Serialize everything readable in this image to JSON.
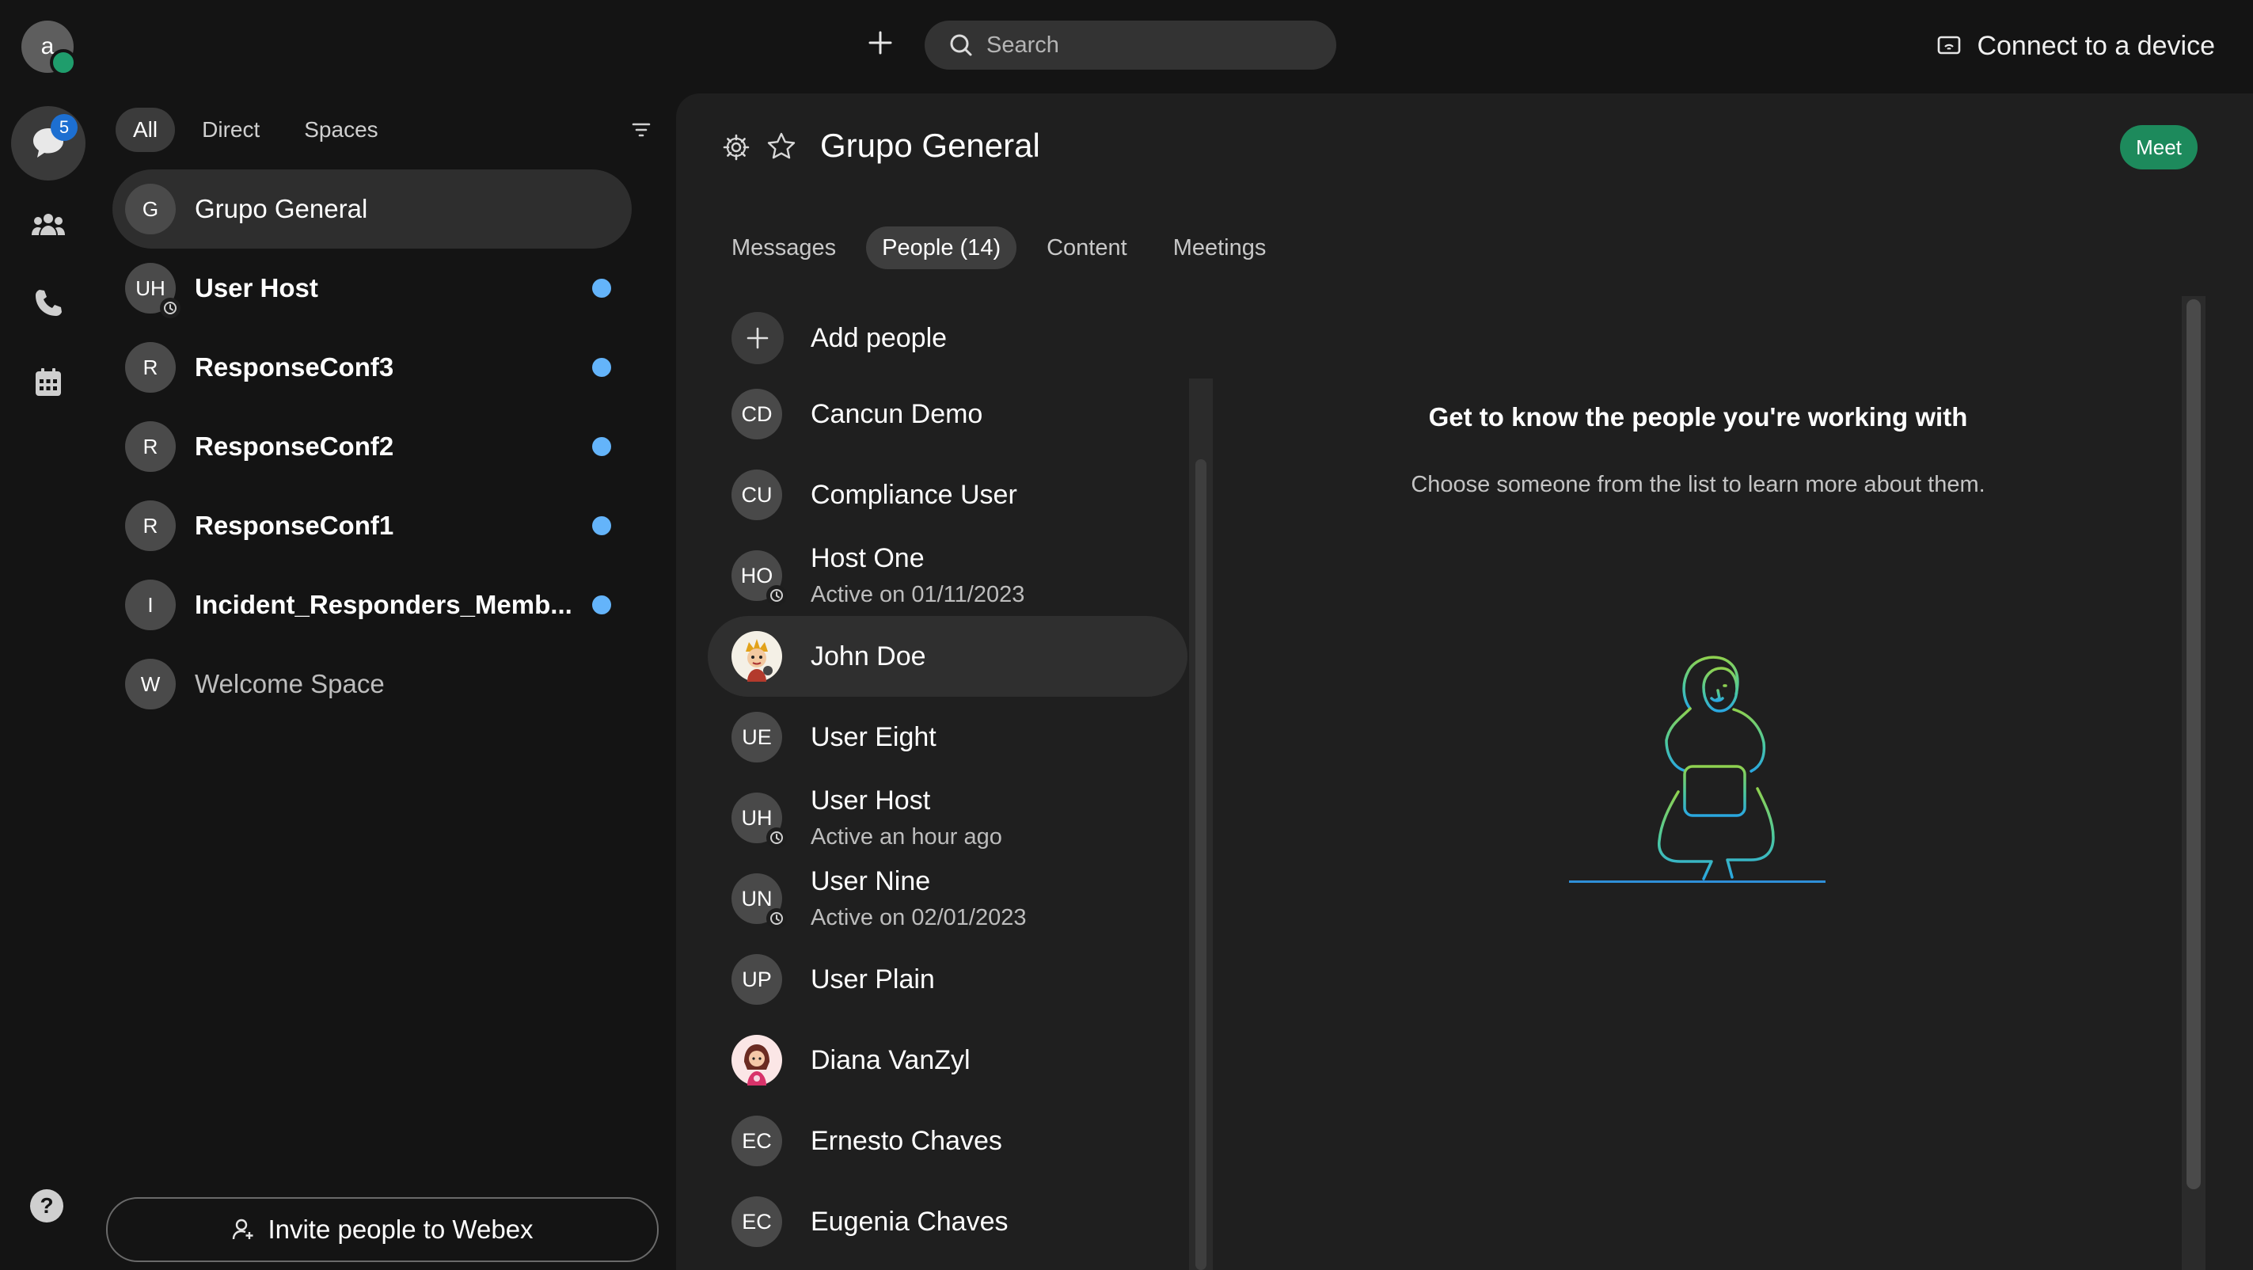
{
  "user": {
    "avatar_initial": "a"
  },
  "search": {
    "placeholder": "Search"
  },
  "connect": {
    "label": "Connect to a device"
  },
  "rail": {
    "messaging_badge": "5"
  },
  "filters": {
    "all": "All",
    "direct": "Direct",
    "spaces": "Spaces"
  },
  "spaces": [
    {
      "initials": "G",
      "name": "Grupo General",
      "style": "active"
    },
    {
      "initials": "UH",
      "name": "User Host",
      "style": "unread",
      "clock": true
    },
    {
      "initials": "R",
      "name": "ResponseConf3",
      "style": "unread"
    },
    {
      "initials": "R",
      "name": "ResponseConf2",
      "style": "unread"
    },
    {
      "initials": "R",
      "name": "ResponseConf1",
      "style": "unread"
    },
    {
      "initials": "I",
      "name": "Incident_Responders_Memb...",
      "style": "unread"
    },
    {
      "initials": "W",
      "name": "Welcome Space",
      "style": "dim"
    }
  ],
  "invite": {
    "label": "Invite people to Webex"
  },
  "help": {
    "label": "?"
  },
  "header": {
    "title": "Grupo General",
    "meet_label": "Meet"
  },
  "tabs": {
    "messages": "Messages",
    "people": "People (14)",
    "content": "Content",
    "meetings": "Meetings"
  },
  "add_people": {
    "label": "Add people"
  },
  "people": [
    {
      "initials": "CD",
      "name": "Cancun Demo",
      "sub": ""
    },
    {
      "initials": "CU",
      "name": "Compliance User",
      "sub": ""
    },
    {
      "initials": "HO",
      "name": "Host One",
      "sub": "Active on 01/11/2023",
      "clock": true
    },
    {
      "initials": "",
      "name": "John Doe",
      "sub": "",
      "photo": "cartoon",
      "active": true
    },
    {
      "initials": "UE",
      "name": "User Eight",
      "sub": ""
    },
    {
      "initials": "UH",
      "name": "User Host",
      "sub": "Active an hour ago",
      "clock": true
    },
    {
      "initials": "UN",
      "name": "User Nine",
      "sub": "Active on 02/01/2023",
      "clock": true
    },
    {
      "initials": "UP",
      "name": "User Plain",
      "sub": ""
    },
    {
      "initials": "",
      "name": "Diana VanZyl",
      "sub": "",
      "photo": "girl"
    },
    {
      "initials": "EC",
      "name": "Ernesto Chaves",
      "sub": ""
    },
    {
      "initials": "EC",
      "name": "Eugenia Chaves",
      "sub": ""
    }
  ],
  "empty_state": {
    "title": "Get to know the people you're working with",
    "subtitle": "Choose someone from the list to learn more about them."
  },
  "colors": {
    "meet": "#1d8a5c",
    "unread_dot": "#64b4fa",
    "badge": "#1d6fd1",
    "presence": "#1f9d6c"
  }
}
